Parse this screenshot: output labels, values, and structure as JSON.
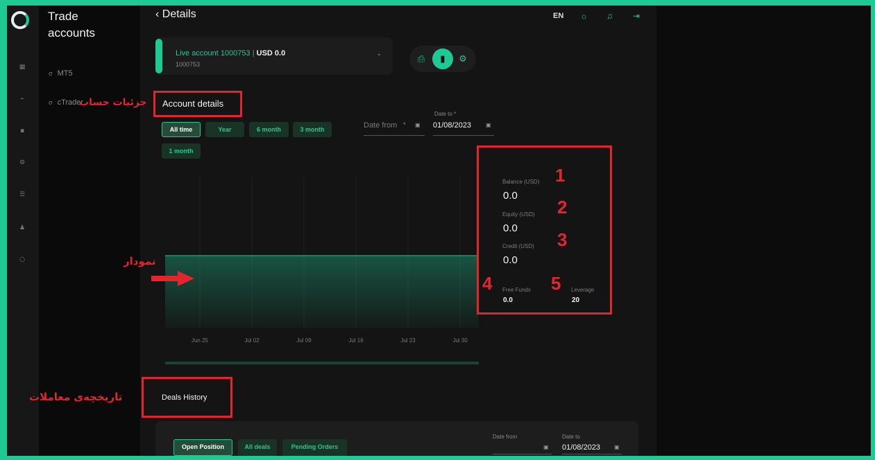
{
  "app": {
    "title": "Trade accounts",
    "rail_icons": [
      "grid-icon",
      "chart-icon",
      "wallet-icon",
      "gear-icon",
      "list-icon",
      "user-icon",
      "chat-icon"
    ],
    "accent": "#1fc994"
  },
  "sidebar": {
    "title": "Trade accounts",
    "items": [
      {
        "label": "MT5",
        "icon": "link-icon"
      },
      {
        "label": "cTrader",
        "icon": "link-icon"
      }
    ]
  },
  "header": {
    "back_label": "Details",
    "language": "EN",
    "icons": [
      "theme-sun-icon",
      "bell-icon",
      "logout-icon"
    ]
  },
  "account": {
    "name": "Live account 1000753",
    "balance_label": "USD 0.0",
    "number": "1000753",
    "tools": [
      "deposit-icon",
      "statistics-icon",
      "settings-icon"
    ]
  },
  "account_details": {
    "title": "Account details",
    "filters": [
      "All time",
      "Year",
      "6 month",
      "3 month",
      "1 month"
    ],
    "active_filter": "All time",
    "date_from": {
      "placeholder": "Date from",
      "required": "*"
    },
    "date_to": {
      "label": "Date to",
      "required": "*",
      "value": "01/08/2023"
    }
  },
  "chart_data": {
    "type": "area",
    "x": [
      "Jun 25",
      "Jul 02",
      "Jul 09",
      "Jul 16",
      "Jul 23",
      "Jul 30"
    ],
    "series": [
      {
        "values": [
          0,
          0,
          0,
          0,
          0,
          0
        ]
      }
    ],
    "grid": true,
    "fill": "#1fc994"
  },
  "stats": {
    "balance": {
      "label": "Balance (USD)",
      "value": "0.0"
    },
    "equity": {
      "label": "Equity (USD)",
      "value": "0.0"
    },
    "credit": {
      "label": "Credit (USD)",
      "value": "0.0"
    },
    "free_funds": {
      "label": "Free Funds",
      "value": "0.0"
    },
    "leverage": {
      "label": "Leverage",
      "value": "20"
    }
  },
  "deals": {
    "title": "Deals History",
    "tabs": [
      "Open Position",
      "All deals",
      "Pending Orders"
    ],
    "active_tab": "Open Position",
    "date_from": {
      "label": "Date from",
      "value": ""
    },
    "date_to": {
      "label": "Date to",
      "value": "01/08/2023"
    }
  },
  "annotations": {
    "numbers": [
      "1",
      "2",
      "3",
      "4",
      "5"
    ],
    "account_details": "جزئیات حساب",
    "chart": "نمودار",
    "deals_history": "تاریخچه‌ی معاملات",
    "color": "#e3262d"
  }
}
